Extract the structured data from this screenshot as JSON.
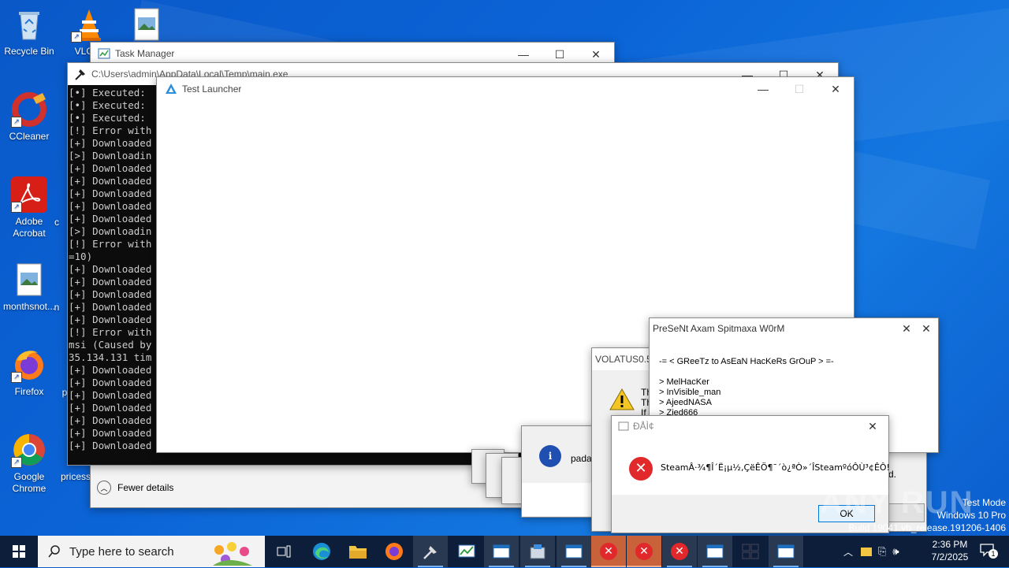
{
  "desktop": {
    "icons": [
      {
        "label": "Recycle Bin"
      },
      {
        "label": "VLC m"
      },
      {
        "label": "CCleaner"
      },
      {
        "label": "Adobe Acrobat"
      },
      {
        "label": "monthsnot..."
      },
      {
        "label": "Firefox"
      },
      {
        "label": "Google Chrome"
      },
      {
        "label": "pricess"
      }
    ],
    "partial_labels": [
      "c",
      "n",
      "p"
    ]
  },
  "task_manager": {
    "title": "Task Manager",
    "fewer_details": "Fewer details"
  },
  "console": {
    "title": "C:\\Users\\admin\\AppData\\Local\\Temp\\main.exe",
    "lines": [
      "[•] Executed:",
      "[•] Executed:",
      "[•] Executed:",
      "[!] Error with",
      "[+] Downloaded",
      "[>] Downloadin",
      "[+] Downloaded",
      "[+] Downloaded",
      "[+] Downloaded",
      "[+] Downloaded",
      "[+] Downloaded",
      "[>] Downloadin",
      "[!] Error with",
      "=10)",
      "[+] Downloaded",
      "[+] Downloaded",
      "[+] Downloaded",
      "[+] Downloaded",
      "[+] Downloaded",
      "[!] Error with",
      "msi (Caused by",
      "35.134.131 tim",
      "[+] Downloaded",
      "[+] Downloaded",
      "[+] Downloaded",
      "[+] Downloaded",
      "[+] Downloaded",
      "[+] Downloaded",
      "[+] Downloaded"
    ]
  },
  "test_launcher": {
    "title": "Test Launcher"
  },
  "volatus": {
    "title": "VOLATUS0.5",
    "lines": [
      "Th",
      "Th",
      "If"
    ],
    "trailing": "d."
  },
  "info_dialog": {
    "text": "pada"
  },
  "worm": {
    "title": "PreSeNt Axam Spitmaxa W0rM",
    "greetz": "-= < GReeTz to AsEaN HacKeRs GrOuP > =-",
    "list": [
      "> MelHacKer",
      "> InVisible_man",
      "> AjeedNASA",
      "> Zied666"
    ]
  },
  "error_dialog": {
    "title": "ÐÅÌ¢",
    "message": "SteamÂ·¾¶Î´Ë¡µ½,ÇëÊÖ¶¯´ò¿ªÒ»´ÎSteamºóÔÙ³¢ÊÔ!",
    "ok": "OK"
  },
  "watermark": {
    "mode": "Test Mode",
    "os": "Windows 10 Pro",
    "build": "Build 19041.vb_release.191206-1406",
    "brand": "ANY RUN"
  },
  "taskbar": {
    "search_placeholder": "Type here to search",
    "time": "2:36 PM",
    "date": "7/2/2025",
    "notif_count": "1"
  },
  "colors": {
    "desktop": "#0b64d6",
    "taskbar": "#0c1e3a",
    "error_red": "#e1282b",
    "err_tab": "#c8623a"
  }
}
